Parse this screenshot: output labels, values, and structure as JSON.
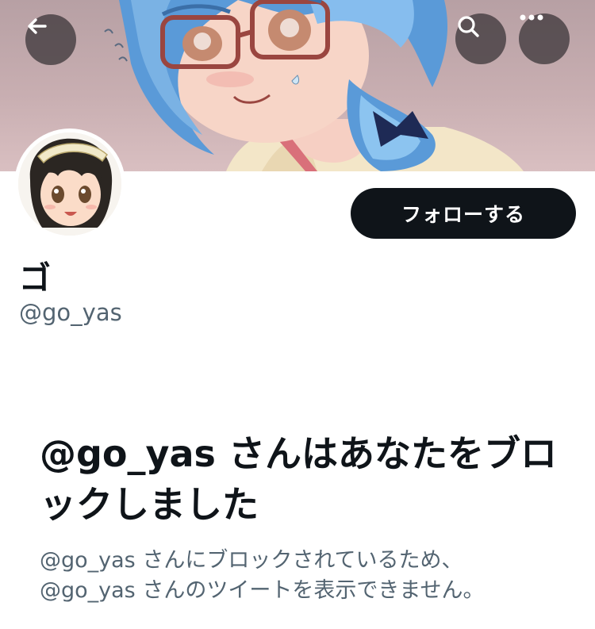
{
  "header": {
    "back_icon": "arrow-left-icon",
    "search_icon": "search-icon",
    "more_icon": "more-horizontal-icon"
  },
  "profile": {
    "display_name": "ゴ",
    "handle": "@go_yas",
    "follow_label": "フォローする"
  },
  "blocked_notice": {
    "title": "@go_yas さんはあなたをブロックしました",
    "description_line1": "@go_yas さんにブロックされているため、",
    "description_line2": "@go_yas さんのツイートを表示できません。"
  },
  "colors": {
    "primary_text": "#0f1419",
    "secondary_text": "#536471",
    "follow_button_bg": "#0f1419",
    "overlay_button_bg": "#463e42"
  }
}
